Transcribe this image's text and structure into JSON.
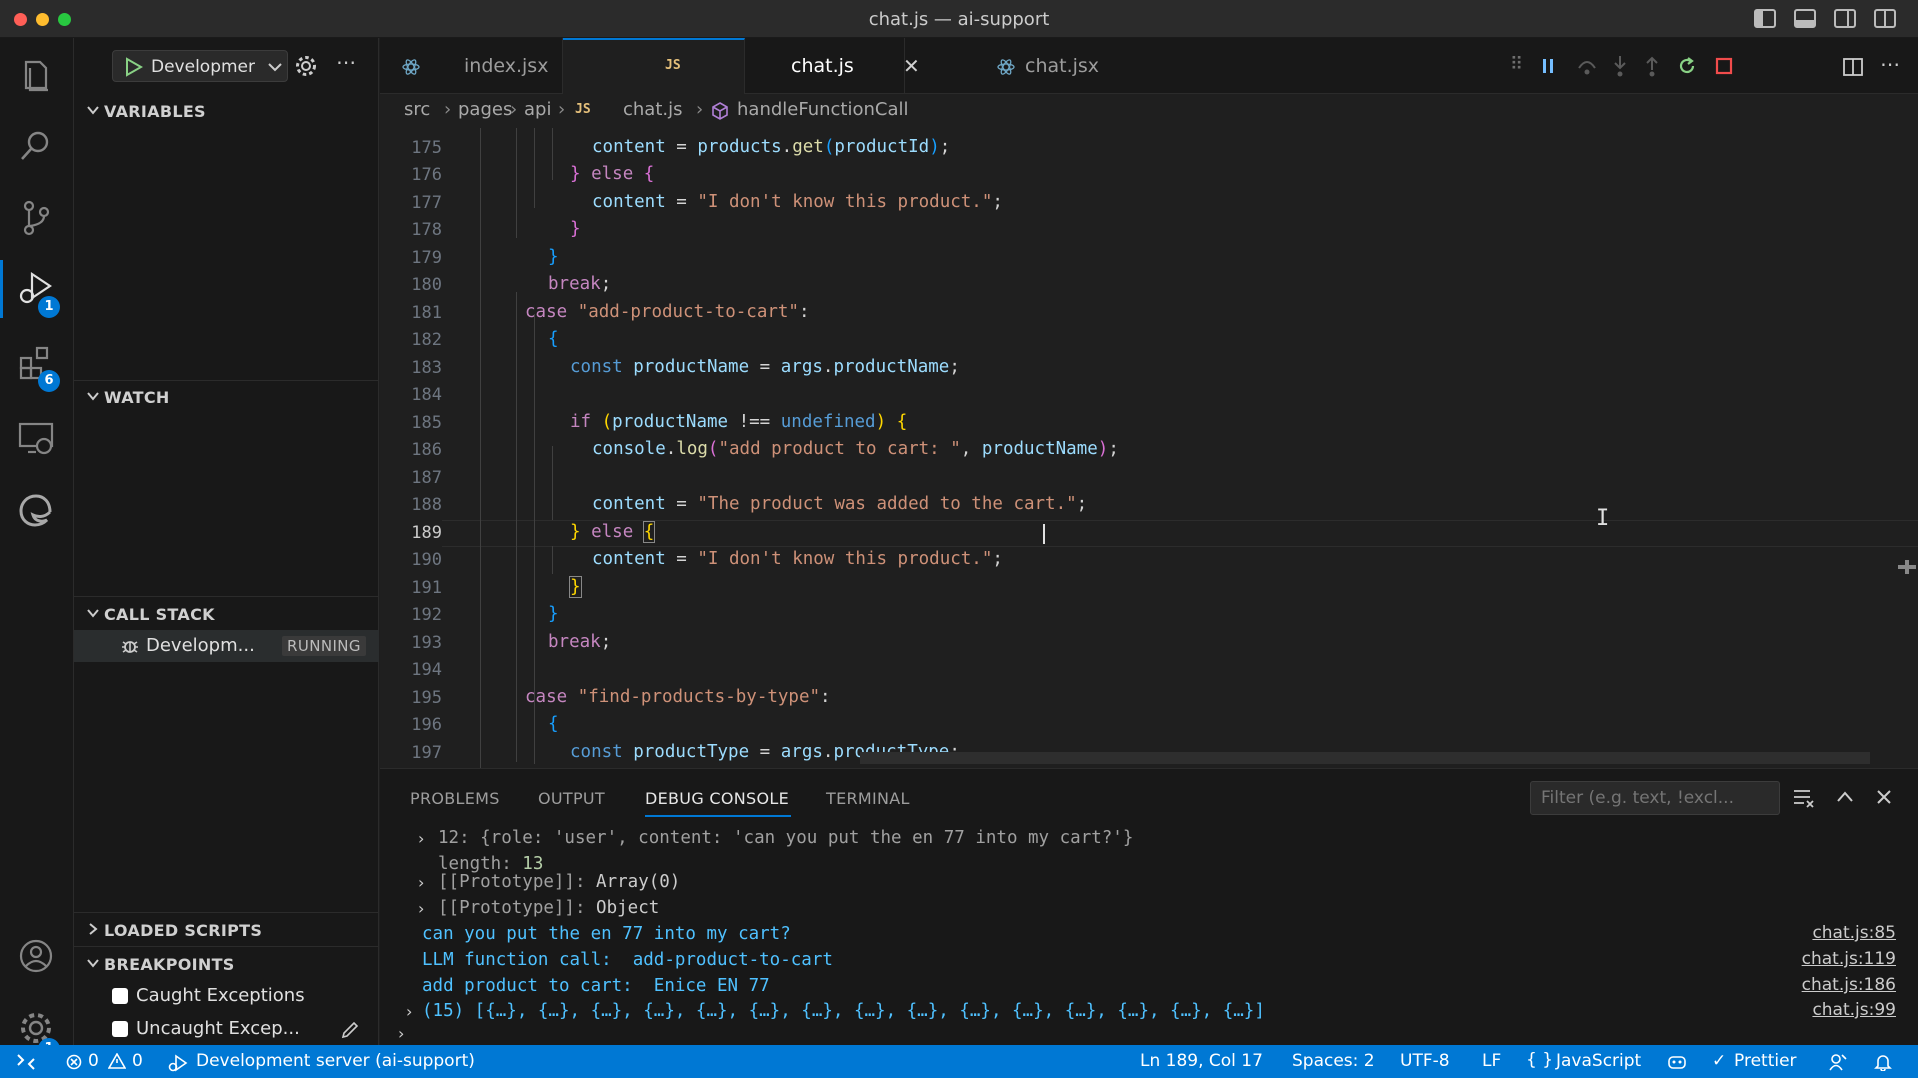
{
  "window": {
    "title": "chat.js — ai-support"
  },
  "activity_bar": {
    "items": [
      {
        "name": "explorer-icon"
      },
      {
        "name": "search-icon"
      },
      {
        "name": "source-control-icon"
      },
      {
        "name": "run-debug-icon",
        "badge": "1"
      },
      {
        "name": "extensions-icon",
        "badge": "6"
      },
      {
        "name": "remote-explorer-icon"
      },
      {
        "name": "edge-devtools-icon"
      }
    ],
    "bottom": [
      {
        "name": "account-icon"
      },
      {
        "name": "manage-gear-icon",
        "badge": "1"
      }
    ]
  },
  "sidebar": {
    "debug_config": "Developmer",
    "sections": {
      "variables": "VARIABLES",
      "watch": "WATCH",
      "call_stack": "CALL STACK",
      "loaded_scripts": "LOADED SCRIPTS",
      "breakpoints": "BREAKPOINTS"
    },
    "call_stack_item": {
      "label": "Developm...",
      "status": "RUNNING"
    },
    "breakpoints": [
      {
        "label": "Caught Exceptions",
        "checked": false
      },
      {
        "label": "Uncaught Excep...",
        "checked": false
      }
    ]
  },
  "tabs": [
    {
      "label": "index.jsx",
      "active": false
    },
    {
      "label": "chat.js",
      "badge": "JS",
      "active": true
    },
    {
      "label": "chat.jsx",
      "active": false
    }
  ],
  "breadcrumb": {
    "parts": [
      "src",
      "pages",
      "api",
      "chat.js",
      "handleFunctionCall"
    ],
    "js_badge": "JS"
  },
  "editor": {
    "line_numbers": [
      "175",
      "176",
      "177",
      "178",
      "179",
      "180",
      "181",
      "182",
      "183",
      "184",
      "185",
      "186",
      "187",
      "188",
      "189",
      "190",
      "191",
      "192",
      "193",
      "194",
      "195",
      "196",
      "197"
    ],
    "current_line": "189"
  },
  "panel": {
    "tabs": [
      "PROBLEMS",
      "OUTPUT",
      "DEBUG CONSOLE",
      "TERMINAL"
    ],
    "active_tab": "DEBUG CONSOLE",
    "filter_placeholder": "Filter (e.g. text, !excl...",
    "console": {
      "line1": "12: {role: 'user', content: 'can you put the en 77 into my cart?'}",
      "line2_key": "length: ",
      "line2_val": "13",
      "line3_key": "[[Prototype]]: ",
      "line3_val": "Array(0)",
      "line4_key": "[[Prototype]]: ",
      "line4_val": "Object",
      "line5": "can you put the en 77 into my cart?",
      "line6": "LLM function call:  add-product-to-cart",
      "line7": "add product to cart:  Enice EN 77",
      "line8": "(15) [{…}, {…}, {…}, {…}, {…}, {…}, {…}, {…}, {…}, {…}, {…}, {…}, {…}, {…}, {…}]"
    },
    "sources": [
      "chat.js:85",
      "chat.js:119",
      "chat.js:186",
      "chat.js:99"
    ]
  },
  "status_bar": {
    "errors": "0",
    "warnings": "0",
    "launch": "Development server (ai-support)",
    "position": "Ln 189, Col 17",
    "spaces": "Spaces: 2",
    "encoding": "UTF-8",
    "eol": "LF",
    "language": "JavaScript",
    "formatter": "Prettier"
  },
  "colors": {
    "accent": "#0078d4",
    "editor_bg": "#1f1f1f",
    "sidebar_bg": "#181818"
  }
}
